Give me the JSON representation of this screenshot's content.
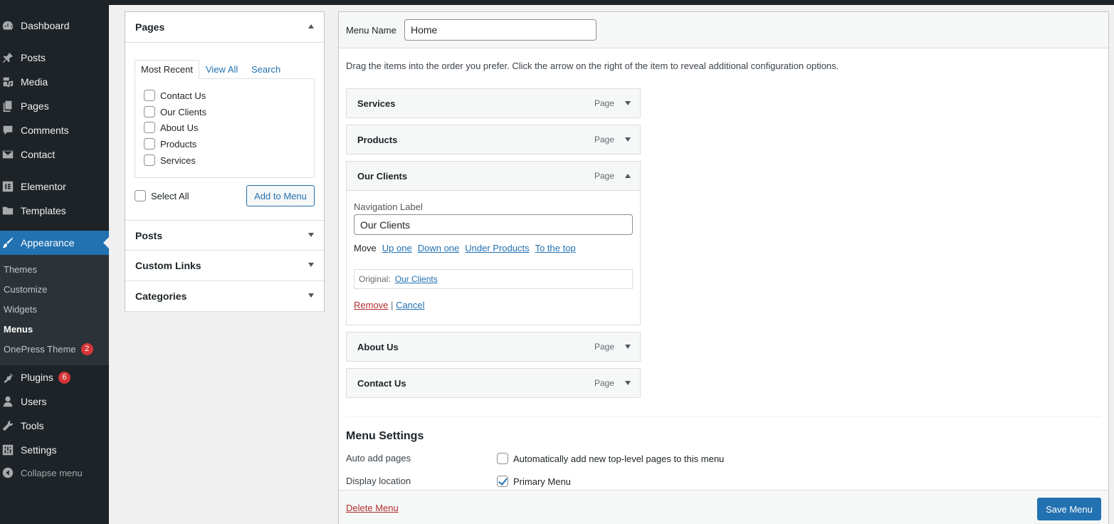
{
  "sidebar": {
    "items": [
      {
        "label": "Dashboard",
        "icon": "dashboard-icon"
      },
      {
        "label": "Posts",
        "icon": "pin-icon"
      },
      {
        "label": "Media",
        "icon": "media-icon"
      },
      {
        "label": "Pages",
        "icon": "pages-icon"
      },
      {
        "label": "Comments",
        "icon": "comment-icon"
      },
      {
        "label": "Contact",
        "icon": "mail-icon"
      },
      {
        "label": "Elementor",
        "icon": "elementor-icon"
      },
      {
        "label": "Templates",
        "icon": "folder-icon"
      },
      {
        "label": "Appearance",
        "icon": "brush-icon"
      },
      {
        "label": "Plugins",
        "icon": "plug-icon",
        "badge": "6"
      },
      {
        "label": "Users",
        "icon": "user-icon"
      },
      {
        "label": "Tools",
        "icon": "wrench-icon"
      },
      {
        "label": "Settings",
        "icon": "settings-icon"
      }
    ],
    "submenu": [
      {
        "label": "Themes"
      },
      {
        "label": "Customize"
      },
      {
        "label": "Widgets"
      },
      {
        "label": "Menus"
      },
      {
        "label": "OnePress Theme",
        "badge": "2"
      }
    ],
    "collapse_label": "Collapse menu"
  },
  "add_items": {
    "pages_title": "Pages",
    "tabs": [
      "Most Recent",
      "View All",
      "Search"
    ],
    "pages": [
      "Contact Us",
      "Our Clients",
      "About Us",
      "Products",
      "Services"
    ],
    "select_all": "Select All",
    "add_button": "Add to Menu",
    "other_boxes": [
      "Posts",
      "Custom Links",
      "Categories"
    ]
  },
  "editor": {
    "menu_name_label": "Menu Name",
    "menu_name_value": "Home",
    "instructions": "Drag the items into the order you prefer. Click the arrow on the right of the item to reveal additional configuration options.",
    "items": [
      {
        "title": "Services",
        "type": "Page"
      },
      {
        "title": "Products",
        "type": "Page"
      },
      {
        "title": "Our Clients",
        "type": "Page"
      },
      {
        "title": "About Us",
        "type": "Page"
      },
      {
        "title": "Contact Us",
        "type": "Page"
      }
    ],
    "expanded": {
      "nav_label_title": "Navigation Label",
      "nav_label_value": "Our Clients",
      "move_label": "Move",
      "move_links": [
        "Up one",
        "Down one",
        "Under Products",
        "To the top"
      ],
      "original_label": "Original:",
      "original_link": "Our Clients",
      "remove": "Remove",
      "separator": "|",
      "cancel": "Cancel"
    },
    "settings": {
      "title": "Menu Settings",
      "auto_add_label": "Auto add pages",
      "auto_add_option": "Automatically add new top-level pages to this menu",
      "auto_add_checked": false,
      "display_location_label": "Display location",
      "display_location_option": "Primary Menu",
      "display_location_checked": true
    },
    "delete_menu": "Delete Menu",
    "save_menu": "Save Menu"
  }
}
